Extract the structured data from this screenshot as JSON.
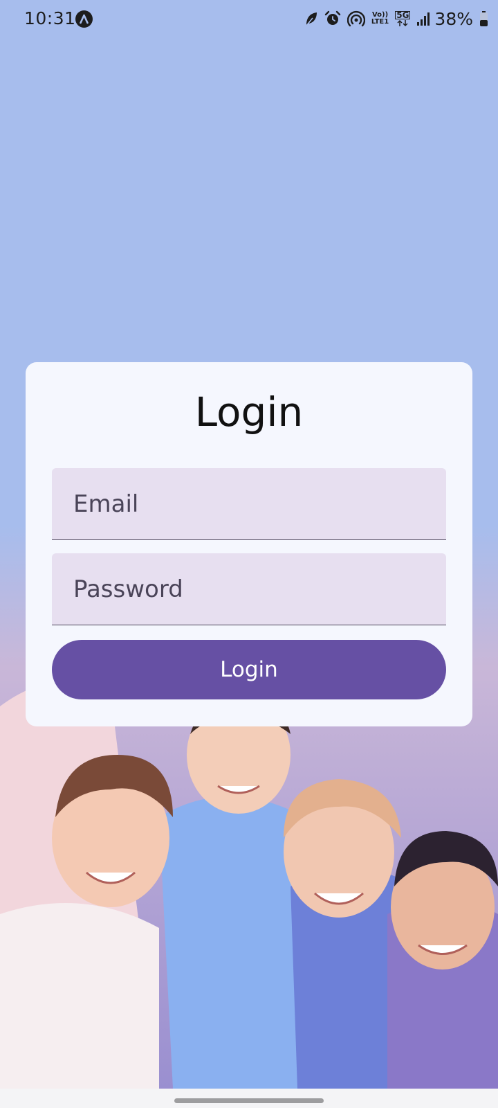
{
  "status_bar": {
    "time": "10:31",
    "battery_percent": "38%",
    "volte_label_top": "Vo))",
    "volte_label_bottom": "LTE1",
    "network_label": "5G",
    "icons": [
      "app-notification-icon",
      "leaf-icon",
      "alarm-icon",
      "hotspot-icon",
      "volte-icon",
      "5g-data-icon",
      "signal-icon",
      "battery-icon"
    ]
  },
  "login": {
    "title": "Login",
    "email_placeholder": "Email",
    "password_placeholder": "Password",
    "button_label": "Login"
  },
  "colors": {
    "background": "#a7bded",
    "card": "#f5f7fe",
    "field": "#e7dff0",
    "button": "#6650a4"
  }
}
